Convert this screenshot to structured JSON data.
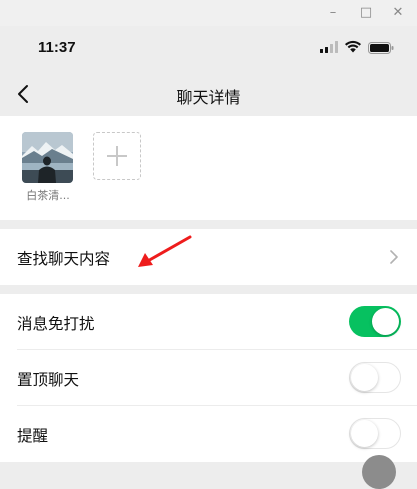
{
  "window": {
    "minimize_glyph": "–",
    "maximize_glyph": "□",
    "close_glyph": "✕"
  },
  "status_bar": {
    "time": "11:37",
    "icons": [
      "cellular-signal-icon",
      "wifi-icon",
      "battery-icon"
    ]
  },
  "nav": {
    "back_icon": "chevron-left-icon",
    "title": "聊天详情"
  },
  "members": [
    {
      "name": "白茶清...",
      "avatar_icon": "landscape-avatar"
    }
  ],
  "add_member_icon": "plus-icon",
  "rows": {
    "search": {
      "label": "查找聊天内容",
      "chevron_icon": "chevron-right-icon"
    },
    "mute": {
      "label": "消息免打扰",
      "enabled": true
    },
    "pin": {
      "label": "置顶聊天",
      "enabled": false
    },
    "remind": {
      "label": "提醒",
      "enabled": false
    }
  },
  "colors": {
    "toggle_on": "#07c160",
    "annotation_arrow": "#ee1c1c",
    "background": "#ededed"
  }
}
